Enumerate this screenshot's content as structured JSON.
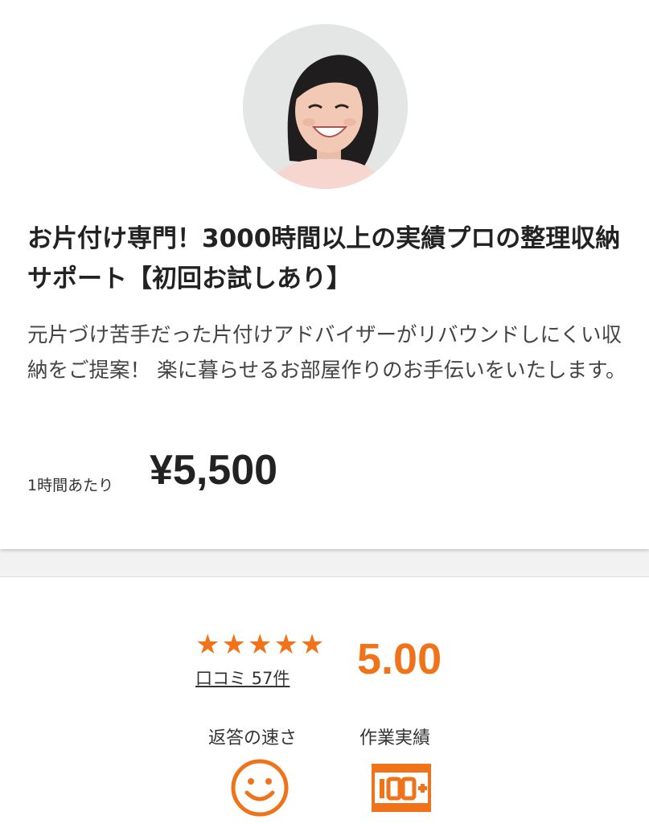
{
  "listing": {
    "title": "お片付け専門！3000時間以上の実績プロの整理収納サポート【初回お試しあり】",
    "description": "元片づけ苦手だった片付けアドバイザーがリバウンドしにくい収納をご提案！ 楽に暮らせるお部屋作りのお手伝いをいたします。",
    "price_unit": "1時間あたり",
    "price": "¥5,500"
  },
  "rating": {
    "stars": "★★★★★",
    "stars_value": 5,
    "reviews_label": "口コミ 57件",
    "score": "5.00"
  },
  "metrics": {
    "speed_label": "返答の速さ",
    "work_label": "作業実績",
    "speed_icon": "smiley-icon",
    "work_icon": "hundred-plus-icon"
  },
  "colors": {
    "accent": "#f0731a"
  }
}
